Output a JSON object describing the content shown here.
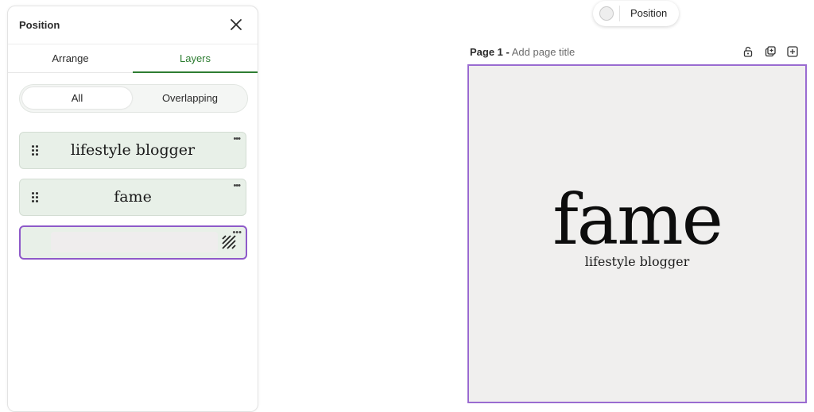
{
  "panel": {
    "title": "Position",
    "tabs": [
      "Arrange",
      "Layers"
    ],
    "active_tab": "Layers",
    "filter": [
      "All",
      "Overlapping"
    ],
    "active_filter": "All",
    "layers": [
      {
        "label": "lifestyle blogger",
        "type": "text"
      },
      {
        "label": "fame",
        "type": "text"
      },
      {
        "label": "",
        "type": "background",
        "selected": true
      }
    ]
  },
  "chip": {
    "label": "Position"
  },
  "page": {
    "label": "Page 1 -",
    "title_placeholder": "Add page title",
    "icons": [
      "lock-icon",
      "duplicate-page-icon",
      "add-page-icon"
    ]
  },
  "design": {
    "headline": "fame",
    "tagline": "lifestyle blogger"
  },
  "colors": {
    "accent_green": "#2e7d32",
    "selection_purple": "#9a6bd1",
    "canvas_bg": "#f0efee",
    "layer_bg": "#e8f0e8"
  }
}
